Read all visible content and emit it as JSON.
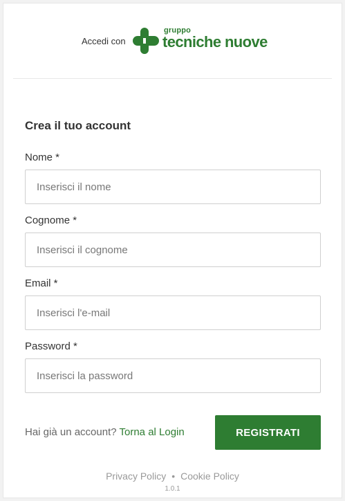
{
  "header": {
    "accedi_label": "Accedi con",
    "logo_small": "gruppo",
    "logo_big": "tecniche nuove",
    "brand_color": "#2e7d32"
  },
  "form": {
    "title": "Crea il tuo account",
    "fields": [
      {
        "label": "Nome *",
        "placeholder": "Inserisci il nome",
        "value": ""
      },
      {
        "label": "Cognome *",
        "placeholder": "Inserisci il cognome",
        "value": ""
      },
      {
        "label": "Email *",
        "placeholder": "Inserisci l'e-mail",
        "value": ""
      },
      {
        "label": "Password *",
        "placeholder": "Inserisci la password",
        "value": ""
      }
    ],
    "have_account_text": "Hai già un account? ",
    "login_link": "Torna al Login",
    "register_button": "REGISTRATI"
  },
  "footer": {
    "privacy": "Privacy Policy",
    "separator": "•",
    "cookie": "Cookie Policy",
    "version": "1.0.1"
  }
}
